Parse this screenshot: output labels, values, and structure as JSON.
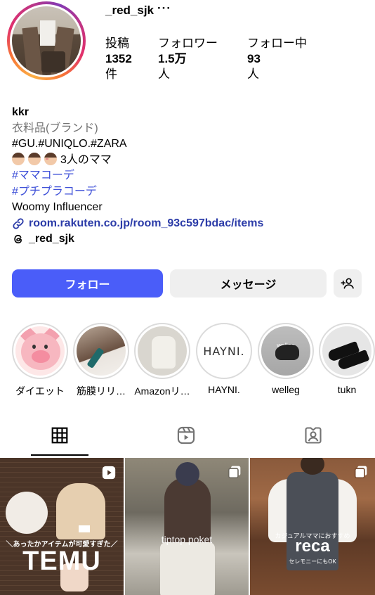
{
  "profile": {
    "username": "_red_sjk",
    "more": "···",
    "stats": [
      {
        "label": "投稿",
        "value": "1352",
        "unit": "件"
      },
      {
        "label": "フォロワー",
        "value": "1.5万",
        "unit": "人"
      },
      {
        "label": "フォロー中",
        "value": "93",
        "unit": "人"
      }
    ]
  },
  "bio": {
    "name": "kkr",
    "category": "衣料品(ブランド)",
    "line1": "#GU.#UNIQLO.#ZARA",
    "line2": "3人のママ",
    "tag1": "#ママコーデ",
    "tag2": "#プチプラコーデ",
    "line3": "Woomy Influencer",
    "link": "room.rakuten.co.jp/room_93c597bdac/items",
    "threads": "_red_sjk"
  },
  "buttons": {
    "follow": "フォロー",
    "message": "メッセージ"
  },
  "highlights": [
    {
      "label": "ダイエット"
    },
    {
      "label": "筋膜リリ…"
    },
    {
      "label": "Amazonリ…"
    },
    {
      "label": "HAYNI."
    },
    {
      "label": "welleg"
    },
    {
      "label": "tukn"
    }
  ],
  "highlight_text": {
    "hayni": "HAYNI.",
    "welleg": "welleg"
  },
  "posts": [
    {
      "sub": "＼あったかアイテムが可愛すぎた／",
      "title": "TEMU"
    },
    {
      "overlay": "tiptop poket"
    },
    {
      "sub": "カジュアルママにおすすめ",
      "title": "reca",
      "sub2": "セレモニーにもOK"
    }
  ],
  "colors": {
    "follow_button": "#4a5df9",
    "link": "#2b3ba8",
    "hashtag": "#3f51d8"
  }
}
